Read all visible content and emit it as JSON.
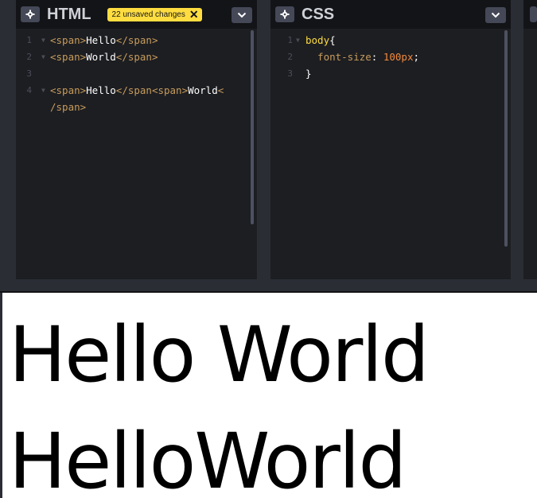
{
  "html_panel": {
    "title": "HTML",
    "badge": "22 unsaved changes",
    "badge_close": "✕",
    "lines": [
      {
        "num": "1",
        "parts": [
          [
            "tag",
            "<span>"
          ],
          [
            "txt",
            "Hello"
          ],
          [
            "tag",
            "</span>"
          ]
        ]
      },
      {
        "num": "2",
        "parts": [
          [
            "tag",
            "<span>"
          ],
          [
            "txt",
            "World"
          ],
          [
            "tag",
            "</span>"
          ]
        ]
      },
      {
        "num": "3",
        "parts": []
      },
      {
        "num": "4",
        "parts": [
          [
            "tag",
            "<span>"
          ],
          [
            "txt",
            "Hello"
          ],
          [
            "tag",
            "</span<span>"
          ],
          [
            "txt",
            "World"
          ],
          [
            "tag",
            "<"
          ]
        ]
      },
      {
        "num": "",
        "parts": [
          [
            "tag",
            "/span>"
          ]
        ]
      }
    ]
  },
  "css_panel": {
    "title": "CSS",
    "lines": [
      {
        "num": "1",
        "parts": [
          [
            "sel",
            "body"
          ],
          [
            "punc",
            "{"
          ]
        ]
      },
      {
        "num": "2",
        "parts": [
          [
            "prop",
            "  font-size"
          ],
          [
            "punc",
            ": "
          ],
          [
            "num",
            "100px"
          ],
          [
            "punc",
            ";"
          ]
        ]
      },
      {
        "num": "3",
        "parts": [
          [
            "punc",
            "}"
          ]
        ]
      }
    ]
  },
  "preview": {
    "line1": "Hello World",
    "line2": "HelloWorld"
  }
}
